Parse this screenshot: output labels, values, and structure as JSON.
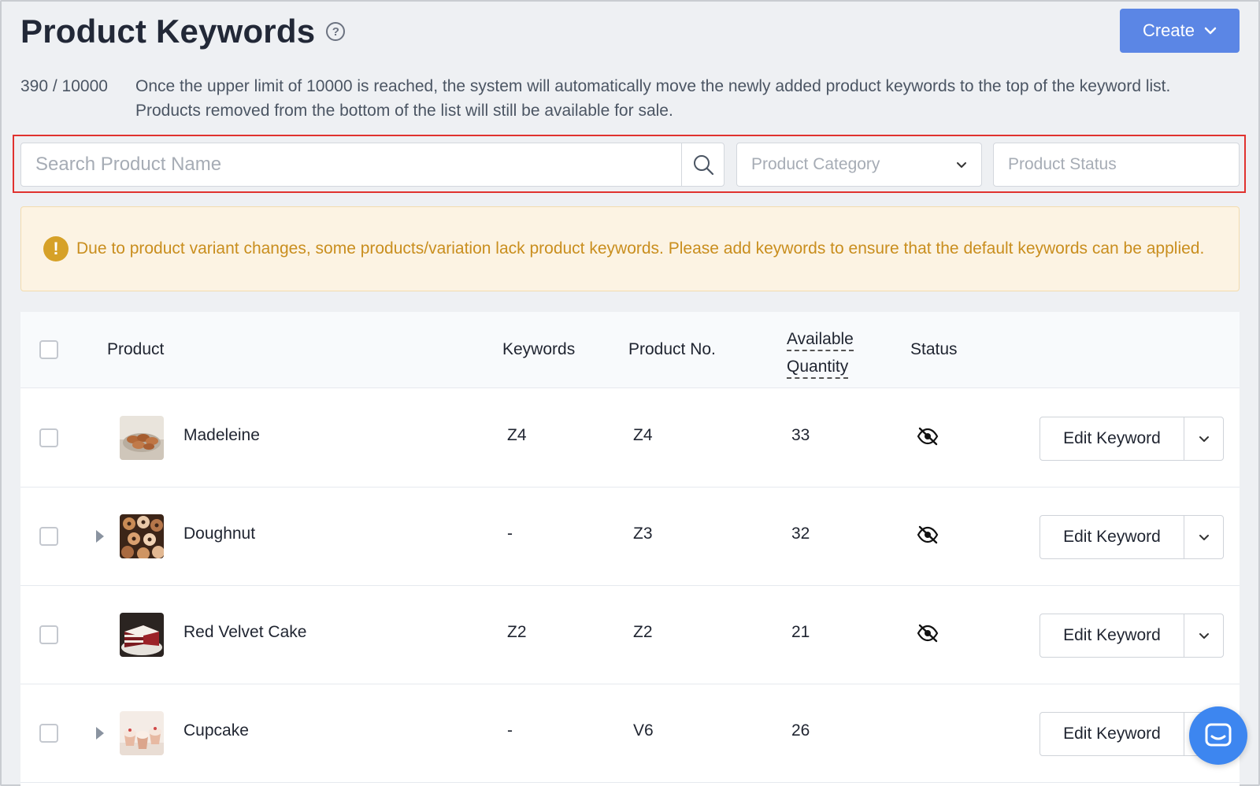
{
  "header": {
    "title": "Product Keywords",
    "help_icon": "question-circle-icon",
    "create_label": "Create"
  },
  "limit": {
    "count": "390 / 10000",
    "message": "Once the upper limit of 10000 is reached, the system will automatically move the newly added product keywords to the top of the keyword list. Products removed from the bottom of the list will still be available for sale."
  },
  "filters": {
    "search_placeholder": "Search Product Name",
    "category_placeholder": "Product Category",
    "status_placeholder": "Product Status"
  },
  "warning": {
    "icon": "exclamation-circle-icon",
    "text": "Due to product variant changes, some products/variation lack product keywords. Please add keywords to ensure that the default keywords can be applied.",
    "color": "#c98e1e"
  },
  "table": {
    "columns": {
      "product": "Product",
      "keywords": "Keywords",
      "product_no": "Product No.",
      "qty_line1": "Available",
      "qty_line2": "Quantity",
      "status": "Status"
    },
    "rows": [
      {
        "name": "Madeleine",
        "keywords": "Z4",
        "product_no": "Z4",
        "qty": "33",
        "status_icon": "eye-slash-icon",
        "action": "Edit Keyword",
        "expandable": false
      },
      {
        "name": "Doughnut",
        "keywords": "-",
        "product_no": "Z3",
        "qty": "32",
        "status_icon": "eye-slash-icon",
        "action": "Edit Keyword",
        "expandable": true
      },
      {
        "name": "Red Velvet Cake",
        "keywords": "Z2",
        "product_no": "Z2",
        "qty": "21",
        "status_icon": "eye-slash-icon",
        "action": "Edit Keyword",
        "expandable": false
      },
      {
        "name": "Cupcake",
        "keywords": "-",
        "product_no": "V6",
        "qty": "26",
        "status_icon": "",
        "action": "Edit Keyword",
        "expandable": true
      }
    ]
  },
  "colors": {
    "accent": "#5b86e5",
    "chat": "#3d86f0",
    "highlight": "#e0322f"
  }
}
